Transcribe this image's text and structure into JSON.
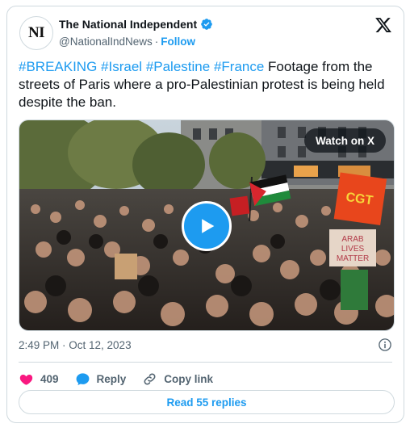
{
  "account": {
    "avatar_text": "NI",
    "display_name": "The National Independent",
    "handle": "@NationalIndNews",
    "separator": "·",
    "follow_label": "Follow"
  },
  "tweet": {
    "hashtags": [
      "#BREAKING",
      "#Israel",
      "#Palestine",
      "#France"
    ],
    "body": "Footage from the streets of Paris where a pro-Palestinian protest is being held despite the ban.",
    "timestamp": "2:49 PM · Oct 12, 2023"
  },
  "media": {
    "watch_label": "Watch on X",
    "sign_text": [
      "ARAB",
      "LIVES",
      "MATTER"
    ],
    "flag_text": "CGT"
  },
  "actions": {
    "likes": "409",
    "reply_label": "Reply",
    "copy_label": "Copy link"
  },
  "replies_button": "Read 55 replies",
  "colors": {
    "accent": "#1d9bf0",
    "like": "#f91880",
    "text": "#0f1419",
    "muted": "#536471",
    "border": "#cfd9de"
  },
  "icons": [
    "verified-badge-icon",
    "x-logo-icon",
    "play-icon",
    "info-icon",
    "heart-icon",
    "reply-bubble-icon",
    "link-icon"
  ]
}
